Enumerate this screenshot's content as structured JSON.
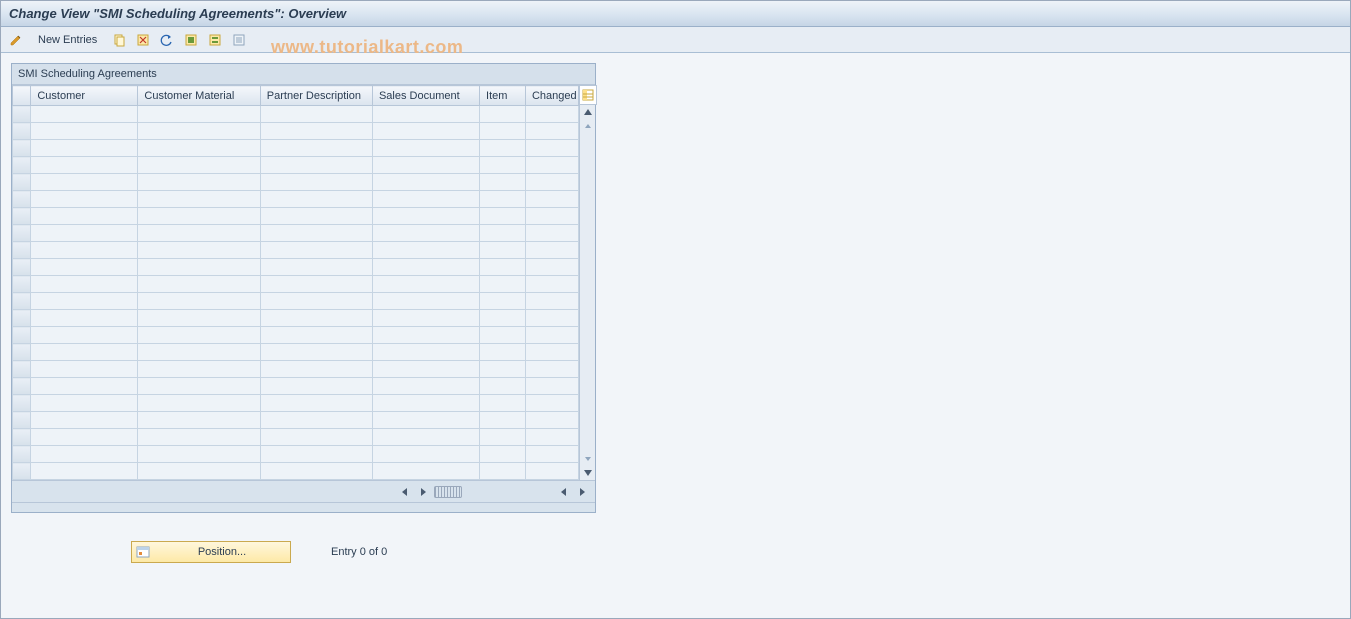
{
  "title": "Change View \"SMI Scheduling Agreements\": Overview",
  "toolbar": {
    "new_entries_label": "New Entries"
  },
  "watermark": "www.tutorialkart.com",
  "panel": {
    "title": "SMI Scheduling Agreements",
    "columns": [
      "Customer",
      "Customer Material",
      "Partner Description",
      "Sales Document",
      "Item",
      "Changed"
    ],
    "rows": [
      [
        "",
        "",
        "",
        "",
        "",
        ""
      ],
      [
        "",
        "",
        "",
        "",
        "",
        ""
      ],
      [
        "",
        "",
        "",
        "",
        "",
        ""
      ],
      [
        "",
        "",
        "",
        "",
        "",
        ""
      ],
      [
        "",
        "",
        "",
        "",
        "",
        ""
      ],
      [
        "",
        "",
        "",
        "",
        "",
        ""
      ],
      [
        "",
        "",
        "",
        "",
        "",
        ""
      ],
      [
        "",
        "",
        "",
        "",
        "",
        ""
      ],
      [
        "",
        "",
        "",
        "",
        "",
        ""
      ],
      [
        "",
        "",
        "",
        "",
        "",
        ""
      ],
      [
        "",
        "",
        "",
        "",
        "",
        ""
      ],
      [
        "",
        "",
        "",
        "",
        "",
        ""
      ],
      [
        "",
        "",
        "",
        "",
        "",
        ""
      ],
      [
        "",
        "",
        "",
        "",
        "",
        ""
      ],
      [
        "",
        "",
        "",
        "",
        "",
        ""
      ],
      [
        "",
        "",
        "",
        "",
        "",
        ""
      ],
      [
        "",
        "",
        "",
        "",
        "",
        ""
      ],
      [
        "",
        "",
        "",
        "",
        "",
        ""
      ],
      [
        "",
        "",
        "",
        "",
        "",
        ""
      ],
      [
        "",
        "",
        "",
        "",
        "",
        ""
      ],
      [
        "",
        "",
        "",
        "",
        "",
        ""
      ],
      [
        "",
        "",
        "",
        "",
        "",
        ""
      ]
    ]
  },
  "footer": {
    "position_label": "Position...",
    "status": "Entry 0 of 0"
  }
}
